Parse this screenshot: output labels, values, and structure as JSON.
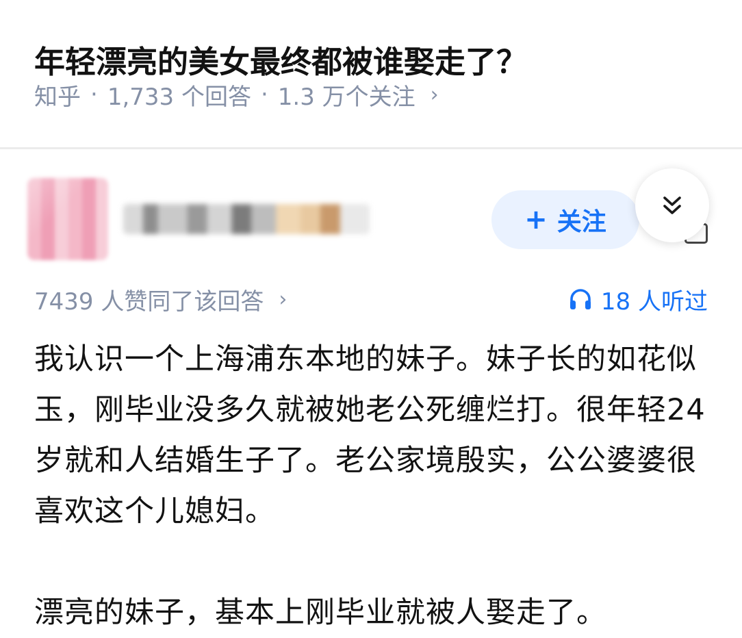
{
  "question": {
    "title": "年轻漂亮的美女最终都被谁娶走了？",
    "source": "知乎",
    "separator": "·",
    "answers_count": "1,733 个回答",
    "followers_count": "1.3 万个关注",
    "chevron": "›"
  },
  "author": {
    "avatar_icon": "blurred-avatar",
    "follow_label": "关注",
    "follow_plus": "+",
    "collapse_icon": "double-chevron-down-icon"
  },
  "stats": {
    "upvotes_text": "7439 人赞同了该回答",
    "chevron": "›",
    "listen_icon": "headphones-icon",
    "listen_text": "18 人听过"
  },
  "answer": {
    "paragraphs": [
      "我认识一个上海浦东本地的妹子。妹子长的如花似玉，刚毕业没多久就被她老公死缠烂打。很年轻24岁就和人结婚生子了。老公家境殷实，公公婆婆很喜欢这个儿媳妇。",
      "漂亮的妹子，基本上刚毕业就被人娶走了。"
    ]
  },
  "colors": {
    "accent": "#1772f6",
    "meta_gray": "#8590a6",
    "follow_bg": "#eaf2ff",
    "text": "#121212"
  }
}
